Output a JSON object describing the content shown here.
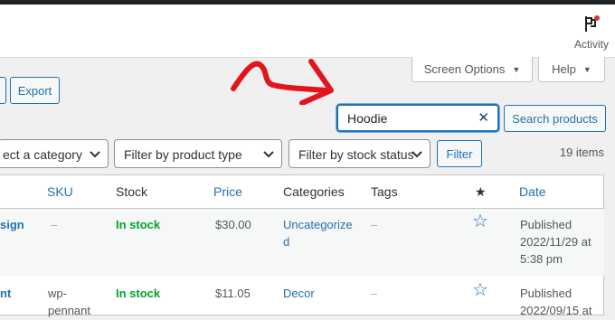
{
  "header": {
    "activity_label": "Activity",
    "activity_icon": "flag-icon"
  },
  "tabs": {
    "screen_options": "Screen Options",
    "help": "Help"
  },
  "toolbar": {
    "export_label": "Export",
    "search_value": "Hoodie",
    "search_button": "Search products",
    "category_filter": "ect a category",
    "product_type_filter": "Filter by product type",
    "stock_status_filter": "Filter by stock status",
    "filter_button": "Filter",
    "items_count": "19 items"
  },
  "table": {
    "columns": {
      "sku": "SKU",
      "stock": "Stock",
      "price": "Price",
      "categories": "Categories",
      "tags": "Tags",
      "date": "Date"
    },
    "rows": [
      {
        "name": "sign",
        "sku": "–",
        "stock": "In stock",
        "price": "$30.00",
        "category_line1": "Uncategorize",
        "category_line2": "d",
        "tags": "–",
        "date_status": "Published",
        "date_line": "2022/11/29 at",
        "time": "5:38 pm"
      },
      {
        "name": "nt",
        "sku_line1": "wp-",
        "sku_line2": "pennant",
        "stock": "In stock",
        "price": "$11.05",
        "category_line1": "Decor",
        "tags": "–",
        "date_status": "Published",
        "date_line": "2022/09/15 at"
      }
    ]
  },
  "colors": {
    "accent": "#2271b1",
    "in_stock": "#00a32a",
    "annotation_arrow": "#e3141c"
  }
}
